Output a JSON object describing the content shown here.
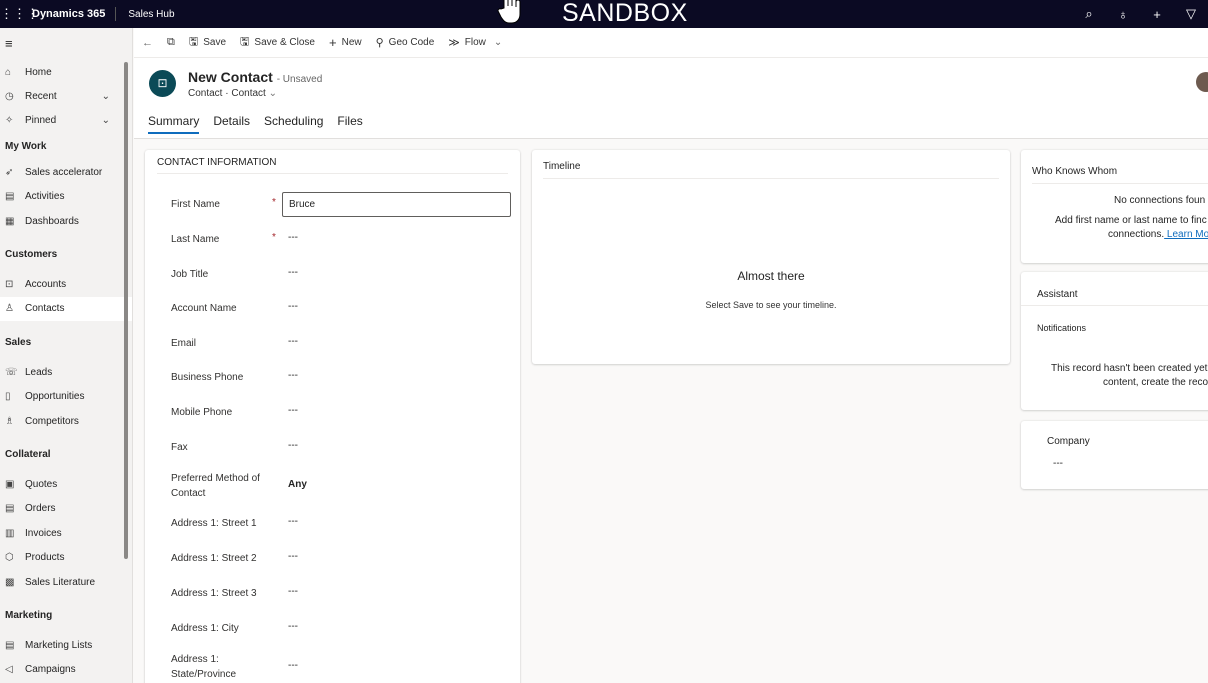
{
  "topbar": {
    "app_name": "Dynamics 365",
    "hub_name": "Sales Hub",
    "banner": "SANDBOX",
    "icons": [
      "search-icon",
      "lightbulb-icon",
      "plus-icon",
      "filter-icon"
    ]
  },
  "nav": {
    "items_top": [
      {
        "label": "Home",
        "icon": "home-icon"
      },
      {
        "label": "Recent",
        "icon": "clock-icon",
        "chevron": true
      },
      {
        "label": "Pinned",
        "icon": "pin-icon",
        "chevron": true
      }
    ],
    "groups": [
      {
        "title": "My Work",
        "items": [
          {
            "label": "Sales accelerator",
            "icon": "rocket-icon"
          },
          {
            "label": "Activities",
            "icon": "clipboard-icon"
          },
          {
            "label": "Dashboards",
            "icon": "dashboard-icon"
          }
        ]
      },
      {
        "title": "Customers",
        "items": [
          {
            "label": "Accounts",
            "icon": "building-icon"
          },
          {
            "label": "Contacts",
            "icon": "person-icon",
            "selected": true
          }
        ]
      },
      {
        "title": "Sales",
        "items": [
          {
            "label": "Leads",
            "icon": "phone-person-icon"
          },
          {
            "label": "Opportunities",
            "icon": "doc-icon"
          },
          {
            "label": "Competitors",
            "icon": "person-plus-icon"
          }
        ]
      },
      {
        "title": "Collateral",
        "items": [
          {
            "label": "Quotes",
            "icon": "quote-icon"
          },
          {
            "label": "Orders",
            "icon": "order-icon"
          },
          {
            "label": "Invoices",
            "icon": "invoice-icon"
          },
          {
            "label": "Products",
            "icon": "box-icon"
          },
          {
            "label": "Sales Literature",
            "icon": "literature-icon"
          }
        ]
      },
      {
        "title": "Marketing",
        "items": [
          {
            "label": "Marketing Lists",
            "icon": "list-icon"
          },
          {
            "label": "Campaigns",
            "icon": "megaphone-icon"
          }
        ]
      }
    ]
  },
  "cmdbar": {
    "back": "←",
    "popout": "⧉",
    "save": "Save",
    "save_close": "Save & Close",
    "new": "New",
    "geo_code": "Geo Code",
    "flow": "Flow"
  },
  "header": {
    "title": "New Contact",
    "unsaved": "- Unsaved",
    "entity": "Contact",
    "form": "Contact",
    "tabs": [
      "Summary",
      "Details",
      "Scheduling",
      "Files"
    ]
  },
  "contact_info": {
    "title": "CONTACT INFORMATION",
    "fields": [
      {
        "label": "First Name",
        "required": true,
        "value": "Bruce",
        "input": true
      },
      {
        "label": "Last Name",
        "required": true,
        "value": "---"
      },
      {
        "label": "Job Title",
        "value": "---"
      },
      {
        "label": "Account Name",
        "value": "---"
      },
      {
        "label": "Email",
        "value": "---"
      },
      {
        "label": "Business Phone",
        "value": "---"
      },
      {
        "label": "Mobile Phone",
        "value": "---"
      },
      {
        "label": "Fax",
        "value": "---"
      },
      {
        "label": "Preferred Method of Contact",
        "value": "Any",
        "bold": true
      },
      {
        "label": "Address 1: Street 1",
        "value": "---"
      },
      {
        "label": "Address 1: Street 2",
        "value": "---"
      },
      {
        "label": "Address 1: Street 3",
        "value": "---"
      },
      {
        "label": "Address 1: City",
        "value": "---"
      },
      {
        "label": "Address 1: State/Province",
        "value": "---"
      }
    ]
  },
  "timeline": {
    "title": "Timeline",
    "heading": "Almost there",
    "message": "Select Save to see your timeline."
  },
  "who_knows": {
    "title": "Who Knows Whom",
    "line1": "No connections foun",
    "line2": "Add first name or last name to finc",
    "line3": "connections.",
    "link": " Learn Mo"
  },
  "assistant": {
    "title": "Assistant",
    "notifications": "Notifications",
    "line1": "This record hasn't been created yet.",
    "line2": "content, create the reco"
  },
  "company": {
    "label": "Company",
    "value": "---"
  },
  "colors": {
    "topbar": "#0b0a23",
    "accent": "#0f6cbd",
    "required": "#a4262c"
  }
}
